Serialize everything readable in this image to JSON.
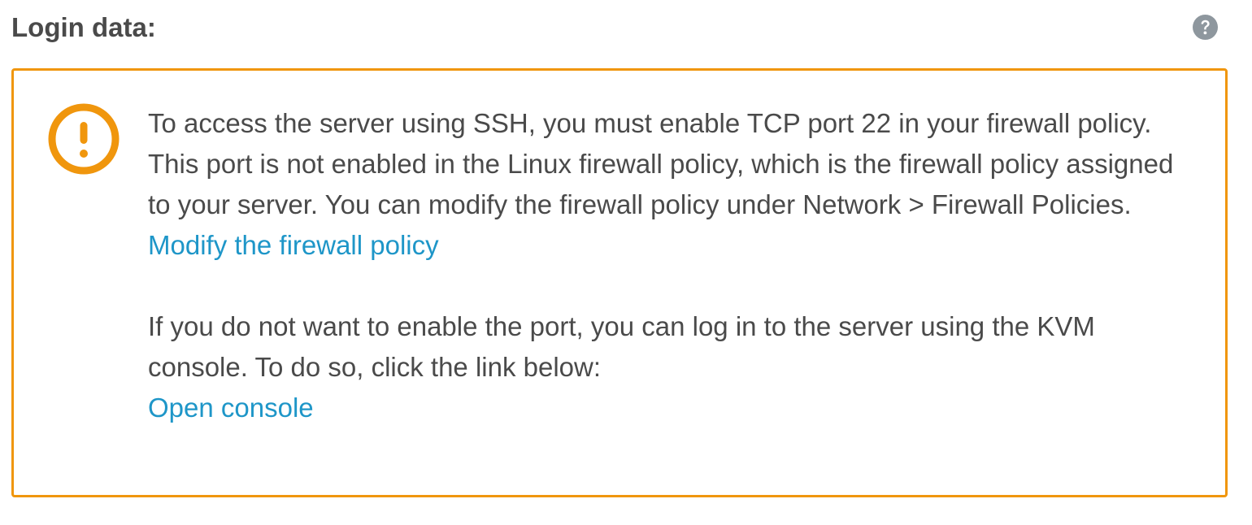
{
  "section": {
    "title": "Login data:",
    "help_icon": "question-circle-icon"
  },
  "alert": {
    "icon": "exclamation-circle-icon",
    "accent_color": "#f0960d",
    "link_color": "#1e96c8",
    "paragraph1": "To access the server using SSH, you must enable TCP port 22 in your firewall policy. This port is not enabled in the Linux firewall policy, which is the firewall policy assigned to your server. You can modify the firewall policy under Network > Firewall Policies.",
    "link1_label": "Modify the firewall policy",
    "paragraph2": "If you do not want to enable the port, you can log in to the server using the KVM console. To do so, click the link below:",
    "link2_label": "Open console"
  }
}
